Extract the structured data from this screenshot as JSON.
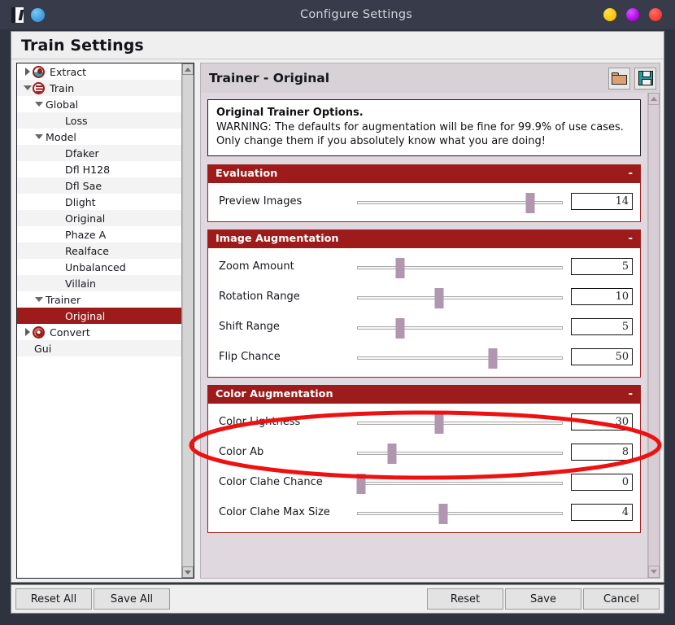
{
  "window": {
    "title": "Configure Settings",
    "icons": [
      "app-glyph-icon",
      "blue-sphere-icon"
    ],
    "controls": [
      "minimize-dot",
      "maximize-dot",
      "close-dot"
    ],
    "colors": {
      "titlebar_bg": "#373b4a",
      "accent_red": "#9e1b1b",
      "slider_handle": "#b096ae",
      "panel_bg": "#dfd8de",
      "annotation": "#ee1111"
    }
  },
  "page": {
    "header_title": "Train Settings"
  },
  "sidebar": {
    "items": [
      {
        "label": "Extract",
        "indent": 0,
        "expander": "right",
        "icon": "extract-icon",
        "selected": false
      },
      {
        "label": "Train",
        "indent": 0,
        "expander": "down",
        "icon": "train-icon",
        "selected": false
      },
      {
        "label": "Global",
        "indent": 1,
        "expander": "down",
        "icon": "",
        "selected": false
      },
      {
        "label": "Loss",
        "indent": 2,
        "expander": "",
        "icon": "",
        "selected": false
      },
      {
        "label": "Model",
        "indent": 1,
        "expander": "down",
        "icon": "",
        "selected": false
      },
      {
        "label": "Dfaker",
        "indent": 2,
        "expander": "",
        "icon": "",
        "selected": false
      },
      {
        "label": "Dfl H128",
        "indent": 2,
        "expander": "",
        "icon": "",
        "selected": false
      },
      {
        "label": "Dfl Sae",
        "indent": 2,
        "expander": "",
        "icon": "",
        "selected": false
      },
      {
        "label": "Dlight",
        "indent": 2,
        "expander": "",
        "icon": "",
        "selected": false
      },
      {
        "label": "Original",
        "indent": 2,
        "expander": "",
        "icon": "",
        "selected": false
      },
      {
        "label": "Phaze A",
        "indent": 2,
        "expander": "",
        "icon": "",
        "selected": false
      },
      {
        "label": "Realface",
        "indent": 2,
        "expander": "",
        "icon": "",
        "selected": false
      },
      {
        "label": "Unbalanced",
        "indent": 2,
        "expander": "",
        "icon": "",
        "selected": false
      },
      {
        "label": "Villain",
        "indent": 2,
        "expander": "",
        "icon": "",
        "selected": false
      },
      {
        "label": "Trainer",
        "indent": 1,
        "expander": "down",
        "icon": "",
        "selected": false
      },
      {
        "label": "Original",
        "indent": 2,
        "expander": "",
        "icon": "",
        "selected": true
      },
      {
        "label": "Convert",
        "indent": 0,
        "expander": "right",
        "icon": "convert-icon",
        "selected": false
      },
      {
        "label": "Gui",
        "indent": 0,
        "expander": "",
        "icon": "",
        "selected": false
      }
    ]
  },
  "panel": {
    "title": "Trainer - Original",
    "toolbar": {
      "load_label": "folder-icon",
      "save_label": "save-icon"
    },
    "info": {
      "heading": "Original Trainer Options.",
      "text": "WARNING: The defaults for augmentation will be fine for 99.9% of use cases. Only change them if you absolutely know what you are doing!"
    },
    "collapse_symbol": "-",
    "sections": [
      {
        "title": "Evaluation",
        "options": [
          {
            "label": "Preview Images",
            "value": "14",
            "slider_pct": 84
          }
        ]
      },
      {
        "title": "Image Augmentation",
        "options": [
          {
            "label": "Zoom Amount",
            "value": "5",
            "slider_pct": 21
          },
          {
            "label": "Rotation Range",
            "value": "10",
            "slider_pct": 40
          },
          {
            "label": "Shift Range",
            "value": "5",
            "slider_pct": 21
          },
          {
            "label": "Flip Chance",
            "value": "50",
            "slider_pct": 66
          }
        ]
      },
      {
        "title": "Color Augmentation",
        "options": [
          {
            "label": "Color Lightness",
            "value": "30",
            "slider_pct": 40
          },
          {
            "label": "Color Ab",
            "value": "8",
            "slider_pct": 17
          },
          {
            "label": "Color Clahe Chance",
            "value": "0",
            "slider_pct": 2
          },
          {
            "label": "Color Clahe Max Size",
            "value": "4",
            "slider_pct": 42
          }
        ]
      }
    ]
  },
  "footer": {
    "reset_all": "Reset All",
    "save_all": "Save All",
    "reset": "Reset",
    "save": "Save",
    "cancel": "Cancel"
  }
}
